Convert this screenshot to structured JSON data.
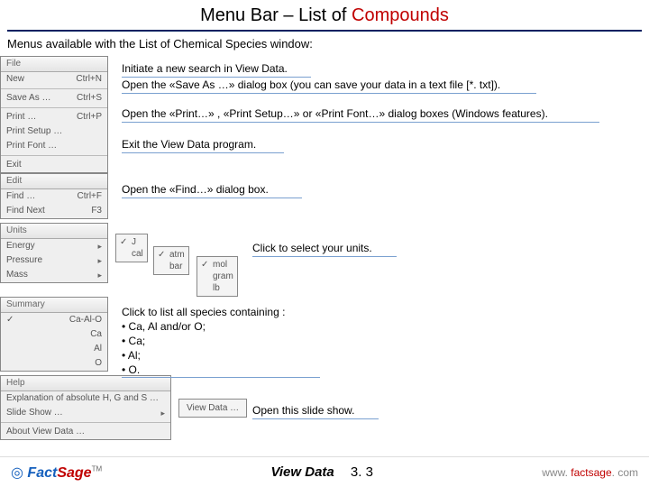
{
  "title_prefix": "Menu Bar – List of ",
  "title_accent": "Compounds",
  "subtitle": "Menus available with the List of Chemical Species window:",
  "file_menu": {
    "head": "File",
    "new": "New",
    "new_sc": "Ctrl+N",
    "saveas": "Save As …",
    "saveas_sc": "Ctrl+S",
    "print": "Print …",
    "print_sc": "Ctrl+P",
    "setup": "Print Setup …",
    "font": "Print Font …",
    "exit": "Exit"
  },
  "edit_menu": {
    "head": "Edit",
    "find": "Find …",
    "find_sc": "Ctrl+F",
    "findnext": "Find Next",
    "findnext_sc": "F3"
  },
  "units_menu": {
    "head": "Units",
    "energy": "Energy",
    "pressure": "Pressure",
    "mass": "Mass",
    "u_j": "J",
    "u_cal": "cal",
    "u_atm": "atm",
    "u_bar": "bar",
    "u_mol": "mol",
    "u_gram": "gram",
    "u_lb": "lb"
  },
  "summary_menu": {
    "head": "Summary",
    "s1": "Ca-Al-O",
    "s2": "Ca",
    "s3": "Al",
    "s4": "O"
  },
  "help_menu": {
    "head": "Help",
    "h1": "Explanation of absolute H, G and S …",
    "h2": "Slide Show …",
    "h3": "About View Data …",
    "vd": "View Data …"
  },
  "desc": {
    "d1": "Initiate a new search in View Data.",
    "d2": "Open the «Save As …» dialog box (you can save your data in a text file [*. txt]).",
    "d3": "Open the «Print…» , «Print Setup…» or «Print Font…» dialog boxes (Windows features).",
    "d4": "Exit the View Data program.",
    "d5": "Open the «Find…» dialog box.",
    "units": "Click to select your units.",
    "list_head": "Click to list all species containing :",
    "l1": "• Ca, Al and/or O;",
    "l2": "• Ca;",
    "l3": "• Al;",
    "l4": "• O.",
    "slide": "Open this slide show."
  },
  "footer": {
    "logo_f": "Fact",
    "logo_s": "Sage",
    "tm": "TM",
    "view_data": "View Data",
    "section": "3. 3",
    "url_pre": "www. ",
    "url_mid": "factsage",
    "url_post": ". com"
  }
}
